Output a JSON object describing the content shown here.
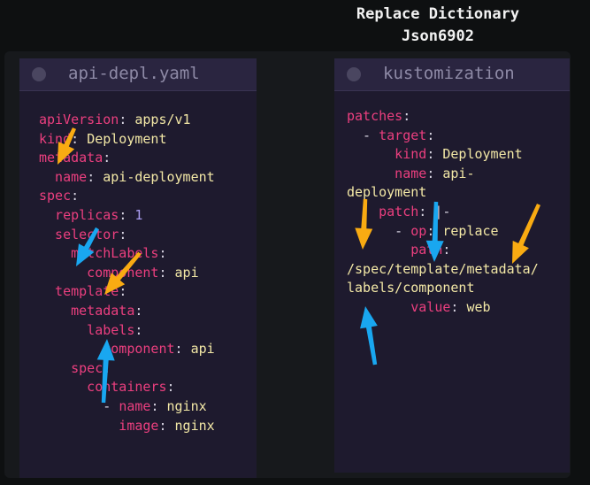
{
  "title": {
    "line1": "Replace Dictionary",
    "line2": "Json6902"
  },
  "left_panel": {
    "filename": "api-depl.yaml",
    "lines": [
      [
        {
          "t": "apiVersion",
          "c": "k"
        },
        {
          "t": ": ",
          "c": "p"
        },
        {
          "t": "apps/v1",
          "c": "v"
        }
      ],
      [
        {
          "t": "kind",
          "c": "k"
        },
        {
          "t": ": ",
          "c": "p"
        },
        {
          "t": "Deployment",
          "c": "v"
        }
      ],
      [
        {
          "t": "metadata",
          "c": "k"
        },
        {
          "t": ":",
          "c": "p"
        }
      ],
      [
        {
          "t": "  name",
          "c": "k"
        },
        {
          "t": ": ",
          "c": "p"
        },
        {
          "t": "api-deployment",
          "c": "v"
        }
      ],
      [
        {
          "t": "spec",
          "c": "k"
        },
        {
          "t": ":",
          "c": "p"
        }
      ],
      [
        {
          "t": "  replicas",
          "c": "k"
        },
        {
          "t": ": ",
          "c": "p"
        },
        {
          "t": "1",
          "c": "n"
        }
      ],
      [
        {
          "t": "  selector",
          "c": "k"
        },
        {
          "t": ":",
          "c": "p"
        }
      ],
      [
        {
          "t": "    matchLabels",
          "c": "k"
        },
        {
          "t": ":",
          "c": "p"
        }
      ],
      [
        {
          "t": "      component",
          "c": "k"
        },
        {
          "t": ": ",
          "c": "p"
        },
        {
          "t": "api",
          "c": "v"
        }
      ],
      [
        {
          "t": "  template",
          "c": "k"
        },
        {
          "t": ":",
          "c": "p"
        }
      ],
      [
        {
          "t": "    metadata",
          "c": "k"
        },
        {
          "t": ":",
          "c": "p"
        }
      ],
      [
        {
          "t": "      labels",
          "c": "k"
        },
        {
          "t": ":",
          "c": "p"
        }
      ],
      [
        {
          "t": "        component",
          "c": "k"
        },
        {
          "t": ": ",
          "c": "p"
        },
        {
          "t": "api",
          "c": "v"
        }
      ],
      [
        {
          "t": "    spec",
          "c": "k"
        },
        {
          "t": ":",
          "c": "p"
        }
      ],
      [
        {
          "t": "      containers",
          "c": "k"
        },
        {
          "t": ":",
          "c": "p"
        }
      ],
      [
        {
          "t": "        - ",
          "c": "p"
        },
        {
          "t": "name",
          "c": "k"
        },
        {
          "t": ": ",
          "c": "p"
        },
        {
          "t": "nginx",
          "c": "v"
        }
      ],
      [
        {
          "t": "          image",
          "c": "k"
        },
        {
          "t": ": ",
          "c": "p"
        },
        {
          "t": "nginx",
          "c": "v"
        }
      ]
    ]
  },
  "right_panel": {
    "filename": "kustomization",
    "lines": [
      [
        {
          "t": "patches",
          "c": "k"
        },
        {
          "t": ":",
          "c": "p"
        }
      ],
      [
        {
          "t": "  - ",
          "c": "p"
        },
        {
          "t": "target",
          "c": "k"
        },
        {
          "t": ":",
          "c": "p"
        }
      ],
      [
        {
          "t": "      kind",
          "c": "k"
        },
        {
          "t": ": ",
          "c": "p"
        },
        {
          "t": "Deployment",
          "c": "v"
        }
      ],
      [
        {
          "t": "      name",
          "c": "k"
        },
        {
          "t": ": ",
          "c": "p"
        },
        {
          "t": "api-",
          "c": "v"
        }
      ],
      [
        {
          "t": "deployment",
          "c": "v"
        }
      ],
      [
        {
          "t": "    patch",
          "c": "k"
        },
        {
          "t": ": ",
          "c": "p"
        },
        {
          "t": "|-",
          "c": "p"
        }
      ],
      [
        {
          "t": "      - ",
          "c": "p"
        },
        {
          "t": "op",
          "c": "k"
        },
        {
          "t": ": ",
          "c": "p"
        },
        {
          "t": "replace",
          "c": "v"
        }
      ],
      [
        {
          "t": "        path",
          "c": "k"
        },
        {
          "t": ":",
          "c": "p"
        }
      ],
      [
        {
          "t": "/spec/template/metadata/",
          "c": "v"
        }
      ],
      [
        {
          "t": "labels/component",
          "c": "v"
        }
      ],
      [
        {
          "t": "        value",
          "c": "k"
        },
        {
          "t": ": ",
          "c": "p"
        },
        {
          "t": "web",
          "c": "v"
        }
      ]
    ]
  },
  "colors": {
    "key": "#ec3f7f",
    "value": "#f3e8a6",
    "punct": "#d9d6e3",
    "number": "#ab9df2",
    "arrow_orange": "#f9ab12",
    "arrow_blue": "#19a7f0"
  },
  "arrows": [
    {
      "name": "arrow-orange-spec",
      "color": "orange"
    },
    {
      "name": "arrow-blue-selector",
      "color": "blue"
    },
    {
      "name": "arrow-orange-template",
      "color": "orange"
    },
    {
      "name": "arrow-blue-labels",
      "color": "blue"
    },
    {
      "name": "arrow-orange-path-slash",
      "color": "orange"
    },
    {
      "name": "arrow-blue-patch",
      "color": "blue"
    },
    {
      "name": "arrow-orange-metadata",
      "color": "orange"
    },
    {
      "name": "arrow-blue-labels-component",
      "color": "blue"
    }
  ]
}
